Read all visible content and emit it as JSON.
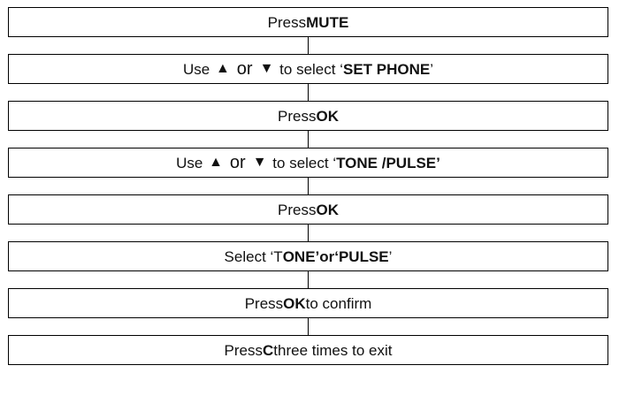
{
  "steps": [
    {
      "prefix": "Press ",
      "bold": "MUTE"
    },
    {
      "use": "Use",
      "up": "▲",
      "or": "or",
      "down": "▼",
      "to_select": "to select ‘",
      "bold": "SET PHONE",
      "suffix": "’"
    },
    {
      "prefix": "Press ",
      "bold": "OK"
    },
    {
      "use": "Use",
      "up": "▲",
      "or": "or",
      "down": "▼",
      "to_select": "to select ‘",
      "bold": "TONE /PULSE’"
    },
    {
      "prefix": "Press ",
      "bold": "OK"
    },
    {
      "prefix": "Select ‘T",
      "bold": "ONE’or‘PULSE",
      "suffix": "’"
    },
    {
      "prefix": "Press ",
      "bold": "OK",
      "suffix": " to confirm"
    },
    {
      "prefix": "Press ",
      "bold": "C",
      "suffix": " three times to exit"
    }
  ]
}
